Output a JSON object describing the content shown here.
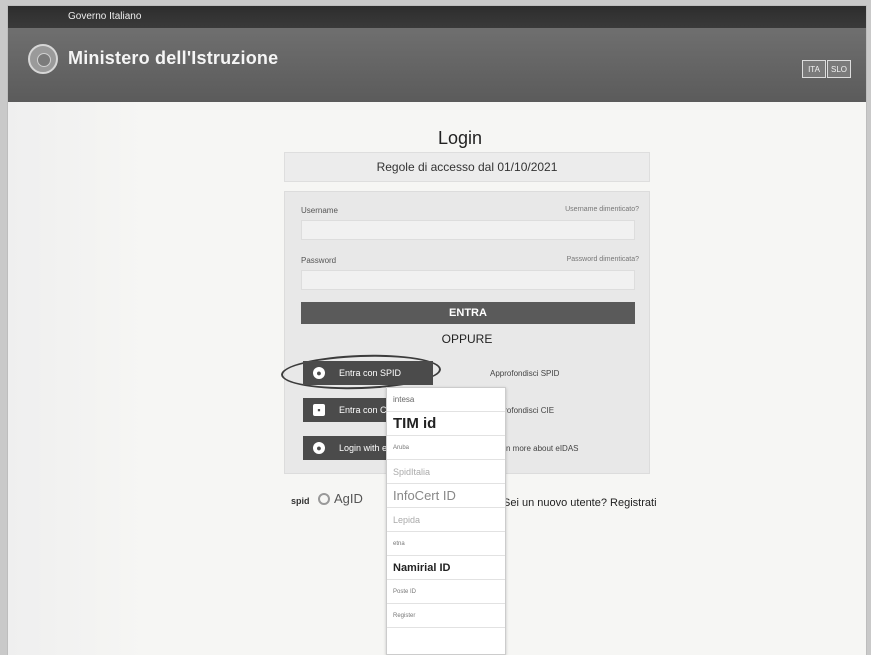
{
  "topbar": {
    "gov_label": "Governo Italiano"
  },
  "header": {
    "title": "Ministero dell'Istruzione",
    "lang_ita": "ITA",
    "lang_slo": "SLO"
  },
  "login": {
    "title": "Login",
    "rules": "Regole di accesso dal 01/10/2021",
    "username_label": "Username",
    "username_forgot": "Username dimenticato?",
    "password_label": "Password",
    "password_forgot": "Password dimenticata?",
    "submit": "ENTRA",
    "oppure": "OPPURE",
    "spid_button": "Entra con SPID",
    "spid_more": "Approfondisci SPID",
    "cie_button": "Entra con CIE",
    "cie_more": "Approfondisci CIE",
    "eidas_button": "Login with eIDAS",
    "eidas_more": "Learn more about eIDAS"
  },
  "footer": {
    "spid_logo": "spid",
    "agid_logo": "AgID",
    "new_user_text": "Sei un nuovo utente?",
    "register_link": "Registrati"
  },
  "spid_providers": [
    "intesa",
    "TIM id",
    "Aruba",
    "SpidItalia",
    "InfoCert ID",
    "Lepida",
    "etna",
    "Namirial ID",
    "Poste ID",
    "Register"
  ],
  "icons": {
    "emblem": "republic-emblem-icon",
    "spid": "person-icon",
    "cie": "id-card-icon",
    "eidas": "eu-person-icon"
  }
}
